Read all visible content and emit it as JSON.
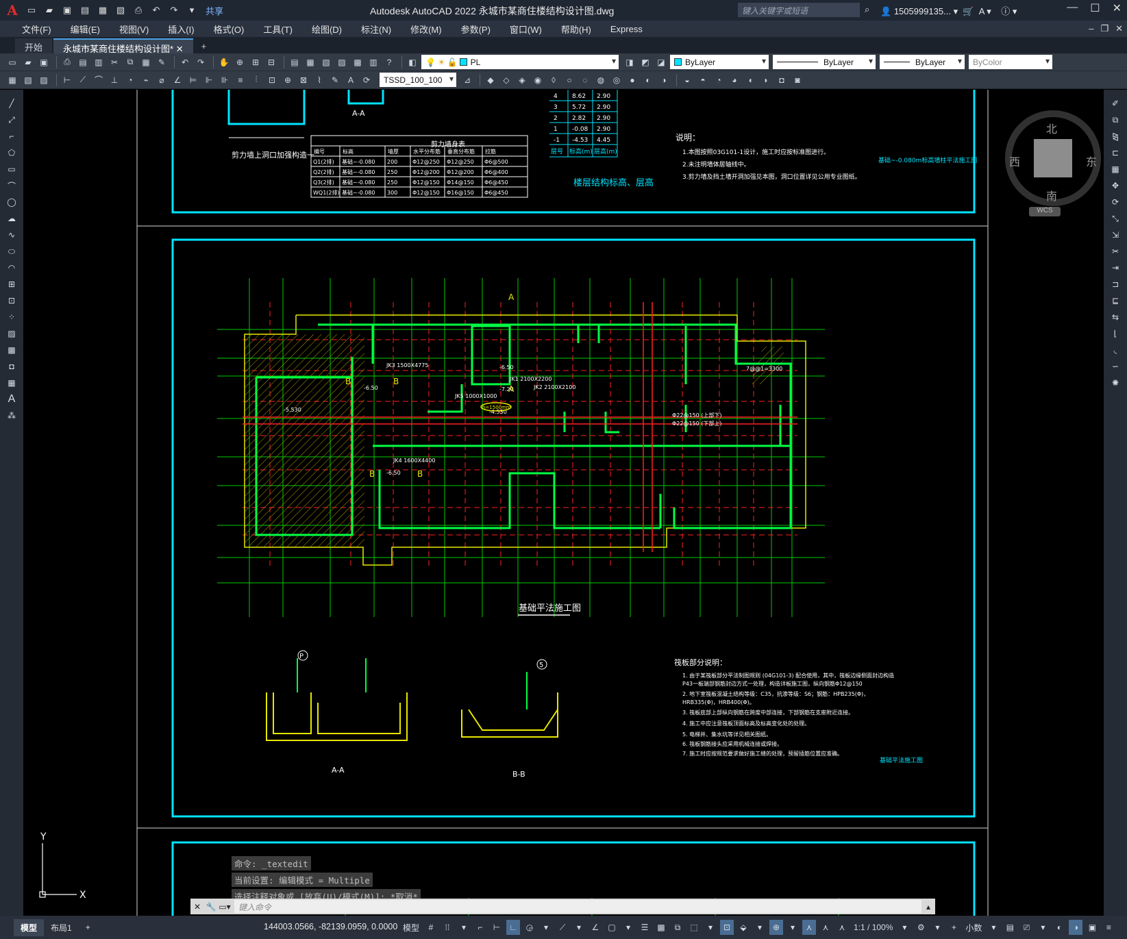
{
  "titlebar": {
    "share": "共享",
    "title": "Autodesk AutoCAD 2022    永城市某商住楼结构设计图.dwg",
    "search_placeholder": "键入关键字或短语",
    "user": "1505999135..."
  },
  "menubar": [
    "文件(F)",
    "编辑(E)",
    "视图(V)",
    "插入(I)",
    "格式(O)",
    "工具(T)",
    "绘图(D)",
    "标注(N)",
    "修改(M)",
    "参数(P)",
    "窗口(W)",
    "帮助(H)",
    "Express"
  ],
  "tabs": {
    "start": "开始",
    "doc": "永城市某商住楼结构设计图*"
  },
  "toolbar1": {
    "layer": "PL",
    "color": "ByLayer",
    "linetype": "ByLayer",
    "lineweight": "ByLayer",
    "plotstyle": "ByColor"
  },
  "toolbar2": {
    "dimstyle": "TSSD_100_100"
  },
  "viewcube": {
    "north": "北",
    "south": "南",
    "east": "东",
    "west": "西",
    "wcs": "WCS"
  },
  "drawing": {
    "title_foundation": "基础平法施工图",
    "wall_table_title": "剪力墙身表",
    "wall_table_headers": [
      "编号",
      "标高",
      "墙厚",
      "水平分布筋",
      "垂直分布筋",
      "拉筋"
    ],
    "wall_table_rows": [
      [
        "Q1(2排)",
        "基础~-0.080",
        "200",
        "Φ12@250",
        "Φ12@250",
        "Φ6@500"
      ],
      [
        "Q2(2排)",
        "基础~-0.080",
        "250",
        "Φ12@200",
        "Φ12@200",
        "Φ6@400"
      ],
      [
        "Q3(2排)",
        "基础~-0.080",
        "250",
        "Φ12@150",
        "Φ14@150",
        "Φ6@450"
      ],
      [
        "WQ1(2排)",
        "基础~-0.080",
        "300",
        "Φ12@150",
        "Φ16@150",
        "Φ6@450"
      ]
    ],
    "floor_rows": [
      [
        "4",
        "8.62",
        "2.90"
      ],
      [
        "3",
        "5.72",
        "2.90"
      ],
      [
        "2",
        "2.82",
        "2.90"
      ],
      [
        "1",
        "-0.08",
        "2.90"
      ],
      [
        "-1",
        "-4.53",
        "4.45"
      ]
    ],
    "floor_headers": [
      "层号",
      "标高(m)",
      "层高(m)"
    ],
    "floor_title": "楼层结构标高、层高",
    "top_notes_title": "说明：",
    "top_notes": [
      "1.本图按照03G101-1设计，施工时应按标准图进行。",
      "2.未注明墙体居轴线中。",
      "3.剪力墙及挡土墙开洞加强见本图，洞口位置详见公用专业图纸。"
    ],
    "top_stamp": "基础~-0.080m标高墙柱平法施工图",
    "opening_title": "剪力墙上洞口加强构造一",
    "section_aa": "A-A",
    "section_bb": "B-B",
    "notes_title": "筏板部分说明：",
    "notes": [
      "1. 由于某筏板部分平法制图规则 (04G101-3) 配合使用，其中，筏板边缘侧面封边构造",
      "   P43一板端部钢筋封边方式一处理，构造详板施工图，纵向钢筋Φ12@150",
      "2. 地下室筏板混凝土结构等级：C35，抗渗等级：S6；钢筋：HPB235(Φ)，",
      "   HRB335(Φ)，HRB400(Φ)。",
      "3. 筏板底部上部纵向钢筋在跨度中部连接，下部钢筋在支座附近连接。",
      "4. 施工中应注意筏板顶面标高及标高变化处的处理。",
      "5. 电梯井、集水坑等详见相关图纸。",
      "6. 筏板钢筋接头应采用机械连接或焊接。",
      "7. 施工时应按规范要求做好施工缝的处理，预留插筋位置应准确。"
    ],
    "bottom_stamp": "基础平法施工图"
  },
  "command": {
    "history": [
      "命令: _textedit",
      "当前设置: 编辑模式 = Multiple",
      "选择注释对象或 [放弃(U)/模式(M)]: *取消*"
    ],
    "placeholder": "键入命令"
  },
  "statusbar": {
    "layout_model": "模型",
    "layout_1": "布局1",
    "coords": "144003.0566, -82139.0959, 0.0000",
    "model": "模型",
    "scale": "1:1 / 100%",
    "units": "小数"
  }
}
